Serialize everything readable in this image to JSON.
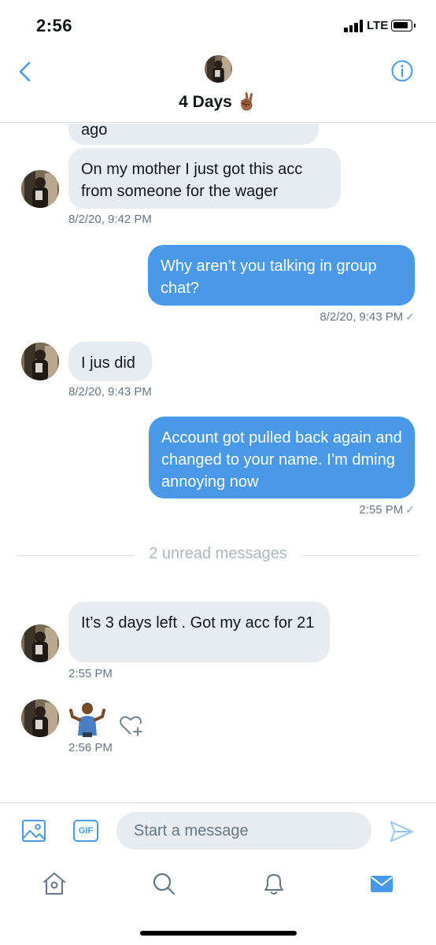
{
  "status_bar": {
    "time": "2:56",
    "network": "LTE"
  },
  "header": {
    "title": "4 Days ✌🏾"
  },
  "messages": [
    {
      "direction": "in",
      "text": "ago"
    },
    {
      "direction": "in",
      "text": "On my mother I just got this acc from someone for the wager",
      "timestamp": "8/2/20, 9:42 PM"
    },
    {
      "direction": "out",
      "text": "Why aren’t you talking in group chat?",
      "timestamp": "8/2/20, 9:43 PM",
      "status": "✓"
    },
    {
      "direction": "in",
      "text": "I jus did",
      "timestamp": "8/2/20, 9:43 PM"
    },
    {
      "direction": "out",
      "text": "Account got pulled back again and changed to your name. I’m dming annoying now",
      "timestamp": "2:55 PM",
      "status": "✓"
    },
    {
      "direction": "in",
      "text": "It’s 3 days left . Got my acc for 21",
      "timestamp": "2:55 PM"
    },
    {
      "direction": "in",
      "emoji": "🤷🏾‍♂️",
      "timestamp": "2:56 PM"
    }
  ],
  "unread_divider": "2 unread messages",
  "composer": {
    "placeholder": "Start a message",
    "gif_label": "GIF"
  },
  "colors": {
    "accent": "#4a99e9",
    "incoming_bubble": "#e6ecf0",
    "muted_text": "#657786"
  },
  "icons": {
    "back": "chevron-left-icon",
    "info": "info-icon",
    "media": "image-icon",
    "send": "send-icon",
    "react": "heart-plus-icon",
    "tabs": [
      "home-icon",
      "search-icon",
      "bell-icon",
      "mail-icon"
    ]
  }
}
